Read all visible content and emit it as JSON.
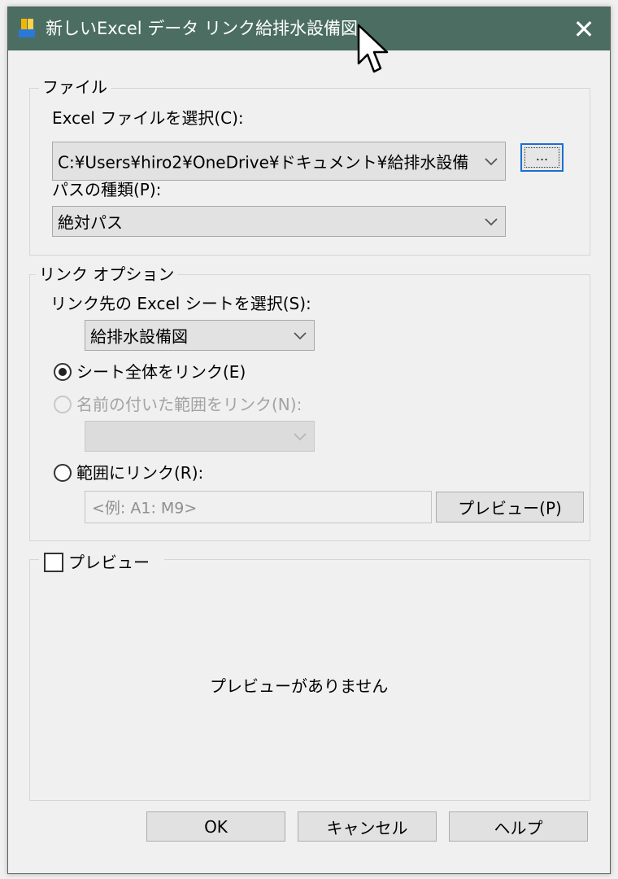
{
  "window": {
    "title": "新しいExcel データ リンク給排水設備図",
    "close_glyph": "✕",
    "titlebar_color": "#4b6d62"
  },
  "file_group": {
    "title": "ファイル",
    "select_label": "Excel ファイルを選択(C):",
    "file_path": "C:¥Users¥hiro2¥OneDrive¥ドキュメント¥給排水設備",
    "browse_label": "...",
    "path_type_label": "パスの種類(P):",
    "path_type_value": "絶対パス"
  },
  "link_group": {
    "title": "リンク オプション",
    "sheet_label": "リンク先の Excel シートを選択(S):",
    "sheet_value": "給排水設備図",
    "option_entire": "シート全体をリンク(E)",
    "option_named": "名前の付いた範囲をリンク(N):",
    "option_range": "範囲にリンク(R):",
    "range_placeholder": "<例: A1: M9>",
    "preview_button": "プレビュー(P)"
  },
  "preview_group": {
    "checkbox_label": "プレビュー",
    "empty_message": "プレビューがありません"
  },
  "footer": {
    "ok": "OK",
    "cancel": "キャンセル",
    "help": "ヘルプ"
  }
}
